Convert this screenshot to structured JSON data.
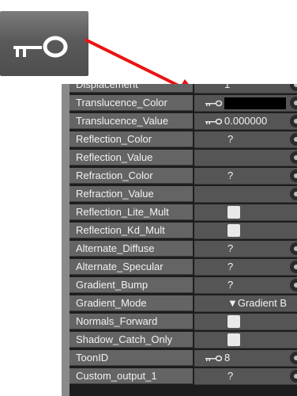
{
  "callout": {
    "icon": "key-icon"
  },
  "rows": [
    {
      "name": "Displacement",
      "type": "number",
      "value": "1",
      "dot": true
    },
    {
      "name": "Translucence_Color",
      "type": "color",
      "key": true,
      "dot": true
    },
    {
      "name": "Translucence_Value",
      "type": "number",
      "key": true,
      "value": "0.000000",
      "dot": true
    },
    {
      "name": "Reflection_Color",
      "type": "q",
      "value": "?",
      "dot": true
    },
    {
      "name": "Reflection_Value",
      "type": "empty",
      "dot": true
    },
    {
      "name": "Refraction_Color",
      "type": "q",
      "value": "?",
      "dot": true
    },
    {
      "name": "Refraction_Value",
      "type": "empty",
      "dot": true
    },
    {
      "name": "Reflection_Lite_Mult",
      "type": "check"
    },
    {
      "name": "Reflection_Kd_Mult",
      "type": "check"
    },
    {
      "name": "Alternate_Diffuse",
      "type": "q",
      "value": "?",
      "dot": true
    },
    {
      "name": "Alternate_Specular",
      "type": "q",
      "value": "?",
      "dot": true
    },
    {
      "name": "Gradient_Bump",
      "type": "q",
      "value": "?",
      "dot": true
    },
    {
      "name": "Gradient_Mode",
      "type": "dropdown",
      "value": "▼Gradient B"
    },
    {
      "name": "Normals_Forward",
      "type": "check"
    },
    {
      "name": "Shadow_Catch_Only",
      "type": "check"
    },
    {
      "name": "ToonID",
      "type": "number",
      "key": true,
      "value": "8",
      "dot": true
    },
    {
      "name": "Custom_output_1",
      "type": "q",
      "value": "?",
      "dot": true
    }
  ]
}
